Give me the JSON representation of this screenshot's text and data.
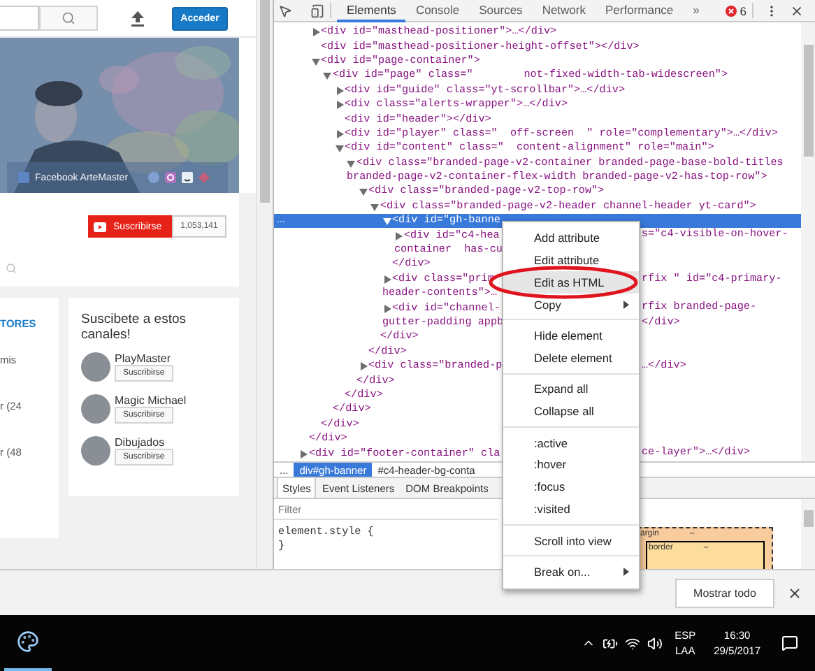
{
  "page": {
    "header": {
      "sign_in": "Acceder"
    },
    "banner": {
      "kind": "picture",
      "link": "Facebook ArteMaster"
    },
    "subscribe": {
      "label": "Suscribirse",
      "count": "1,053,141"
    },
    "left_card": [
      {
        "kind": "heading",
        "text": "TORES"
      },
      {
        "kind": "body",
        "text": "mis"
      },
      {
        "kind": "body",
        "text": "r (24"
      },
      {
        "kind": "body",
        "text": "r (48"
      }
    ],
    "channels_card": {
      "title": "Suscibete a estos canales!",
      "channels": [
        {
          "name": "PlayMaster",
          "button": "Suscribirse"
        },
        {
          "name": "Magic Michael",
          "button": "Suscribirse"
        },
        {
          "name": "Dibujados",
          "button": "Suscribirse"
        }
      ]
    }
  },
  "devtools": {
    "tabs": [
      {
        "label": "Elements",
        "selected": true
      },
      {
        "label": "Console",
        "selected": false
      },
      {
        "label": "Sources",
        "selected": false
      },
      {
        "label": "Network",
        "selected": false
      },
      {
        "label": "Performance",
        "selected": false
      }
    ],
    "more": "»",
    "error_count": "6",
    "tree": [
      {
        "closing": "</div>",
        "children": [
          {
            "text": "<div id=\"masthead-positioner\">…</div>",
            "expanded": false,
            "selected": false
          },
          {
            "text": "<div id=\"masthead-positioner-height-offset\"></div>",
            "selected": false
          },
          {
            "text": "<div id=\"page-container\">",
            "expanded": true,
            "selected": false,
            "closing": "</div>",
            "children": [
              {
                "text": "<div id=\"page\" class=\"        not-fixed-width-tab-widescreen\">",
                "expanded": true,
                "selected": false,
                "closing": "</div>",
                "children": [
                  {
                    "text": "<div id=\"guide\" class=\"yt-scrollbar\">…</div>",
                    "expanded": false,
                    "selected": false
                  },
                  {
                    "text": "<div class=\"alerts-wrapper\">…</div>",
                    "expanded": false,
                    "selected": false
                  },
                  {
                    "text": "<div id=\"header\"></div>",
                    "selected": false
                  },
                  {
                    "text": "<div id=\"player\" class=\"  off-screen  \" role=\"complementary\">…</div>",
                    "expanded": false,
                    "selected": false
                  },
                  {
                    "text": "<div id=\"content\" class=\"  content-alignment\" role=\"main\">",
                    "expanded": true,
                    "selected": false,
                    "closing": "</div>",
                    "children": [
                      {
                        "text": "<div class=\"branded-page-v2-container branded-page-base-bold-titles",
                        "wrap": "branded-page-v2-container-flex-width branded-page-v2-has-top-row\">",
                        "expanded": true,
                        "selected": false,
                        "closing": "</div>",
                        "children": [
                          {
                            "text": "<div class=\"branded-page-v2-top-row\">",
                            "expanded": true,
                            "selected": false,
                            "closing": "</div>",
                            "children": [
                              {
                                "text": "<div class=\"branded-page-v2-header channel-header yt-card\">",
                                "expanded": true,
                                "selected": false,
                                "closing": "</div>",
                                "children": [
                                  {
                                    "text": "<div id=\"gh-banne",
                                    "marker": "...",
                                    "expanded": true,
                                    "selected": true,
                                    "closing": "</div>",
                                    "children": [
                                      {
                                        "text": "<div id=\"c4-hea",
                                        "tail": "s=\"c4-visible-on-hover-",
                                        "wrap": "container  has-cu",
                                        "expanded": false,
                                        "selected": false
                                      }
                                    ]
                                  },
                                  {
                                    "text": "<div class=\"prim",
                                    "tail": "rfix \" id=\"c4-primary-",
                                    "wrap": "header-contents\">…",
                                    "expanded": false,
                                    "selected": false
                                  },
                                  {
                                    "text": "<div id=\"channel-",
                                    "tail": "rfix branded-page-",
                                    "wrap": "gutter-padding appb",
                                    "wrap_tail": "</div>",
                                    "expanded": false,
                                    "selected": false
                                  }
                                ]
                              }
                            ]
                          },
                          {
                            "text": "<div class=\"branded-p",
                            "tail": "…</div>",
                            "expanded": false,
                            "selected": false
                          }
                        ]
                      }
                    ]
                  }
                ]
              }
            ]
          }
        ]
      },
      {
        "text": "<div id=\"footer-container\" cla",
        "tail": "ce-layer\">…</div>",
        "expanded": false,
        "selected": false
      }
    ],
    "breadcrumbs": [
      {
        "label": "...",
        "selected": false
      },
      {
        "label": "div#gh-banner",
        "selected": true
      },
      {
        "label": "#c4-header-bg-conta",
        "selected": false
      }
    ],
    "subtabs": [
      {
        "label": "Styles",
        "selected": true
      },
      {
        "label": "Event Listeners",
        "selected": false
      },
      {
        "label": "DOM Breakpoints",
        "selected": false
      }
    ],
    "filter": {
      "placeholder": "Filter"
    },
    "styles": [
      "element.style {",
      "}"
    ],
    "box_model": [
      {
        "label": "argin",
        "value": "–"
      },
      {
        "label": "border",
        "value": "–"
      }
    ]
  },
  "context_menu": [
    {
      "kind": "item",
      "label": "Add attribute",
      "selected": false,
      "submenu": false,
      "circled": false
    },
    {
      "kind": "item",
      "label": "Edit attribute",
      "selected": false,
      "submenu": false,
      "circled": false
    },
    {
      "kind": "item",
      "label": "Edit as HTML",
      "selected": true,
      "submenu": false,
      "circled": true
    },
    {
      "kind": "item",
      "label": "Copy",
      "selected": false,
      "submenu": true,
      "circled": false
    },
    {
      "kind": "separator"
    },
    {
      "kind": "item",
      "label": "Hide element",
      "selected": false,
      "submenu": false,
      "circled": false
    },
    {
      "kind": "item",
      "label": "Delete element",
      "selected": false,
      "submenu": false,
      "circled": false
    },
    {
      "kind": "separator"
    },
    {
      "kind": "item",
      "label": "Expand all",
      "selected": false,
      "submenu": false,
      "circled": false
    },
    {
      "kind": "item",
      "label": "Collapse all",
      "selected": false,
      "submenu": false,
      "circled": false
    },
    {
      "kind": "separator"
    },
    {
      "kind": "item",
      "label": ":active",
      "selected": false,
      "submenu": false,
      "circled": false
    },
    {
      "kind": "item",
      "label": ":hover",
      "selected": false,
      "submenu": false,
      "circled": false
    },
    {
      "kind": "item",
      "label": ":focus",
      "selected": false,
      "submenu": false,
      "circled": false
    },
    {
      "kind": "item",
      "label": ":visited",
      "selected": false,
      "submenu": false,
      "circled": false
    },
    {
      "kind": "separator"
    },
    {
      "kind": "item",
      "label": "Scroll into view",
      "selected": false,
      "submenu": false,
      "circled": false
    },
    {
      "kind": "separator"
    },
    {
      "kind": "item",
      "label": "Break on...",
      "selected": false,
      "submenu": true,
      "circled": false
    }
  ],
  "download_bar": {
    "button": "Mostrar todo"
  },
  "taskbar": {
    "language": "ESP",
    "layout": "LAA",
    "time": "16:30",
    "date": "29/5/2017"
  }
}
